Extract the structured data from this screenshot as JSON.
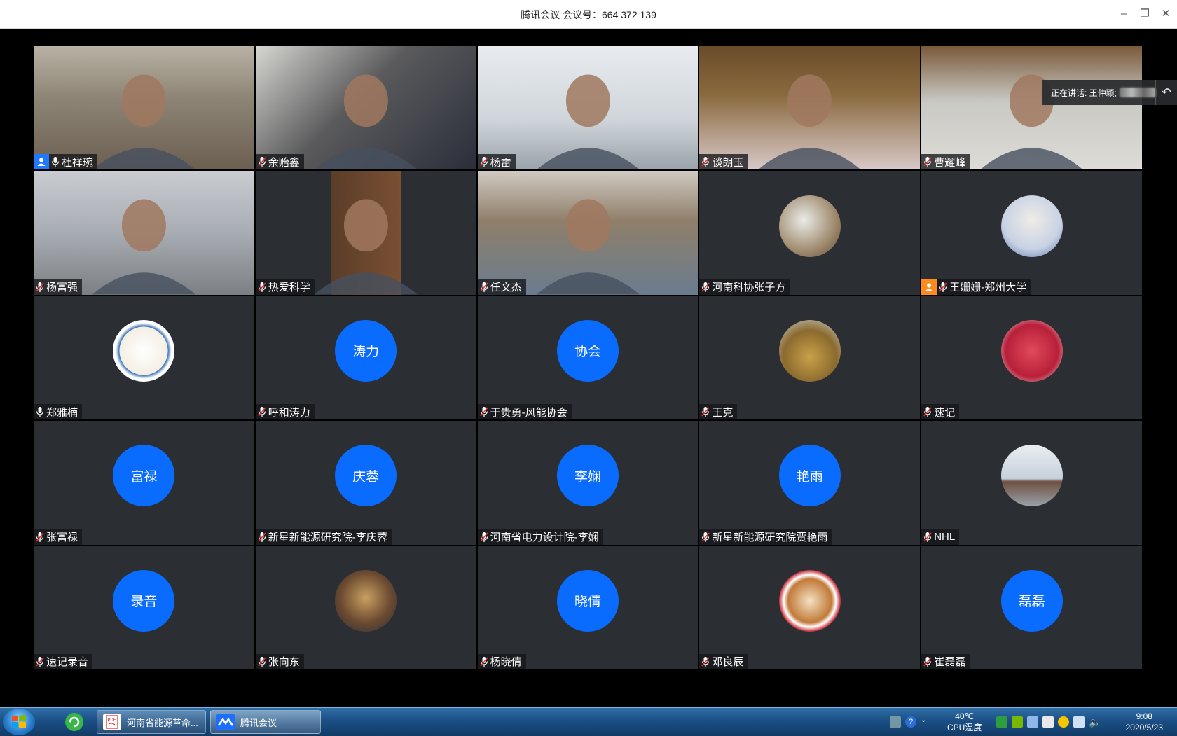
{
  "window": {
    "title": "腾讯会议 会议号：664 372 139"
  },
  "speaking": {
    "label": "正在讲话: 王仲颖;"
  },
  "participants": [
    {
      "name": "杜祥琬",
      "kind": "video",
      "host": true
    },
    {
      "name": "余贻鑫",
      "kind": "video"
    },
    {
      "name": "杨雷",
      "kind": "video"
    },
    {
      "name": "谈朗玉",
      "kind": "video"
    },
    {
      "name": "曹耀峰",
      "kind": "video"
    },
    {
      "name": "杨富强",
      "kind": "video"
    },
    {
      "name": "热爱科学",
      "kind": "video"
    },
    {
      "name": "任文杰",
      "kind": "video"
    },
    {
      "name": "河南科协张子方",
      "kind": "avatar-image"
    },
    {
      "name": "王姗姗-郑州大学",
      "kind": "avatar-image",
      "cohost": true
    },
    {
      "name": "郑雅楠",
      "kind": "avatar-image"
    },
    {
      "name": "呼和涛力",
      "kind": "avatar-text",
      "initials": "涛力"
    },
    {
      "name": "于贵勇-风能协会",
      "kind": "avatar-text",
      "initials": "协会"
    },
    {
      "name": "王克",
      "kind": "avatar-image"
    },
    {
      "name": "速记",
      "kind": "avatar-image"
    },
    {
      "name": "张富禄",
      "kind": "avatar-text",
      "initials": "富禄"
    },
    {
      "name": "新星新能源研究院-李庆蓉",
      "kind": "avatar-text",
      "initials": "庆蓉"
    },
    {
      "name": "河南省电力设计院-李娴",
      "kind": "avatar-text",
      "initials": "李娴"
    },
    {
      "name": "新星新能源研究院贾艳雨",
      "kind": "avatar-text",
      "initials": "艳雨"
    },
    {
      "name": "NHL",
      "kind": "avatar-image"
    },
    {
      "name": "速记录音",
      "kind": "avatar-text",
      "initials": "录音"
    },
    {
      "name": "张向东",
      "kind": "avatar-image"
    },
    {
      "name": "杨晓倩",
      "kind": "avatar-text",
      "initials": "晓倩"
    },
    {
      "name": "邓良辰",
      "kind": "avatar-image"
    },
    {
      "name": "崔磊磊",
      "kind": "avatar-text",
      "initials": "磊磊"
    }
  ],
  "taskbar": {
    "tasks": [
      {
        "label": "河南省能源革命..."
      },
      {
        "label": "腾讯会议"
      }
    ],
    "cpu_temp": "40℃",
    "cpu_label": "CPU温度",
    "time": "9:08",
    "date": "2020/5/23"
  },
  "colors": {
    "avatar_blue": "#0a6cff",
    "tile_bg": "#2b2e33",
    "host_badge": "#1e7bff",
    "cohost_badge": "#ff8a1e"
  }
}
